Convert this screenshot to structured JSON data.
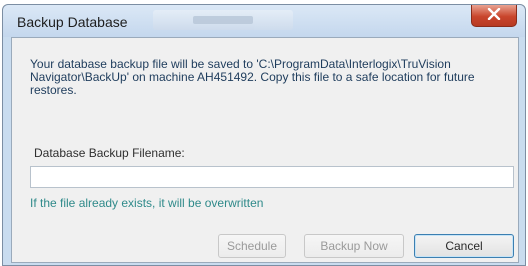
{
  "window": {
    "title": "Backup Database",
    "close_icon": "close-icon"
  },
  "dialog": {
    "message": "Your database backup file will be saved to 'C:\\ProgramData\\Interlogix\\TruVision Navigator\\BackUp' on machine AH451492. Copy this file to a safe location for future restores.",
    "filename_label": "Database Backup Filename:",
    "filename_value": "",
    "hint": "If the file already exists, it will be overwritten"
  },
  "buttons": {
    "schedule_label": "Schedule",
    "backup_now_label": "Backup Now",
    "cancel_label": "Cancel"
  },
  "colors": {
    "hint_text": "#2f8a8a",
    "message_text": "#1e3c5c",
    "close_button": "#c9452c"
  }
}
